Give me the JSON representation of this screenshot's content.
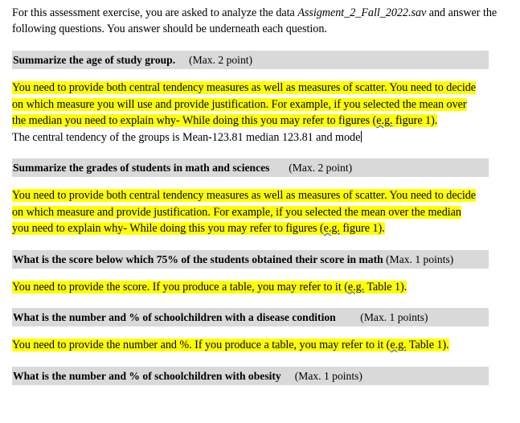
{
  "document": {
    "intro": {
      "text_before": "For this assessment exercise, you are asked to analyze the data ",
      "filename": "Assigment_2_Fall_2022.sav",
      "text_after": " and answer the following questions. You answer should be underneath each question."
    },
    "colors": {
      "heading_background": "#d9d9d9",
      "highlight": "#ffff00",
      "text": "#000000",
      "spellcheck_underline": "#3355cc"
    },
    "sections": [
      {
        "heading": "Summarize the age of study group.",
        "max_points": "(Max. 2 point)",
        "instruction_before_eg": "You need to provide both central tendency measures as well as measures of scatter. You need to decide on which measure you will use and provide justification. For example, if you selected the mean over the median you need to explain why- While doing this you may refer to figures (",
        "instruction_eg": "e.g.",
        "instruction_after_eg": " figure 1).",
        "answer": "The central tendency of the groups is Mean-123.81 median 123.81 and mode"
      },
      {
        "heading": "Summarize the grades of students in math and sciences",
        "max_points": "(Max. 2 point)",
        "instruction_before_eg": "You need to provide both central tendency measures as well as measures of scatter. You need to decide on which measure and provide justification. For example, if you selected the mean over the median you need to explain why- While doing this you may refer to figures (",
        "instruction_eg": "e.g.",
        "instruction_after_eg": " figure 1)."
      },
      {
        "heading": "What is the score below which 75% of the students obtained their score in math",
        "max_points": "(Max. 1 points)",
        "instruction_before_eg": "You need to provide the score. If you produce a table, you may refer to it (",
        "instruction_eg": "e.g.",
        "instruction_after_eg": " Table 1)."
      },
      {
        "heading": "What is the number and % of schoolchildren with a disease condition",
        "max_points": "(Max. 1 points)",
        "instruction_before_eg": "You need to provide the number and %. If you produce a table, you may refer to it (",
        "instruction_eg": "e.g.",
        "instruction_after_eg": " Table 1)."
      },
      {
        "heading": "What is the number and % of schoolchildren with obesity",
        "max_points": "(Max. 1 points)"
      }
    ]
  }
}
